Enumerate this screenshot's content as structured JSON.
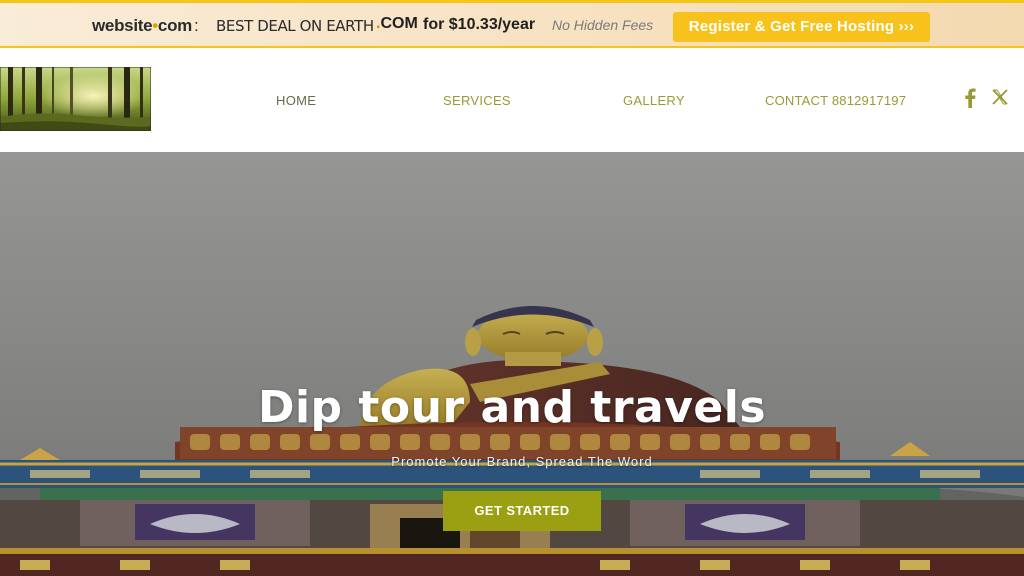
{
  "promo": {
    "brand_name": "website",
    "brand_dot": "•",
    "brand_tld": "com",
    "brand_sep": ":",
    "deal_text": "BEST DEAL ON EARTH",
    "tld_dot": ".",
    "tld_text": "COM",
    "price_text": "for $10.33/year",
    "no_hidden_fees": "No Hidden Fees",
    "register_label": "Register & Get Free Hosting ›››",
    "accent_color": "#f5c518"
  },
  "header": {
    "logo_icon": "forest-logo",
    "nav": {
      "home": "HOME",
      "services": "SERVICES",
      "gallery": "GALLERY",
      "contact": "CONTACT 8812917197"
    },
    "social": {
      "facebook_icon": "facebook-icon",
      "x_icon": "x-icon"
    },
    "nav_color": "#9a9a34"
  },
  "hero": {
    "title": "Dip tour and travels",
    "subtitle": "Promote Your Brand, Spread The Word",
    "cta_label": "GET STARTED",
    "cta_color": "#9aa012",
    "background_image": "buddha-statue"
  }
}
